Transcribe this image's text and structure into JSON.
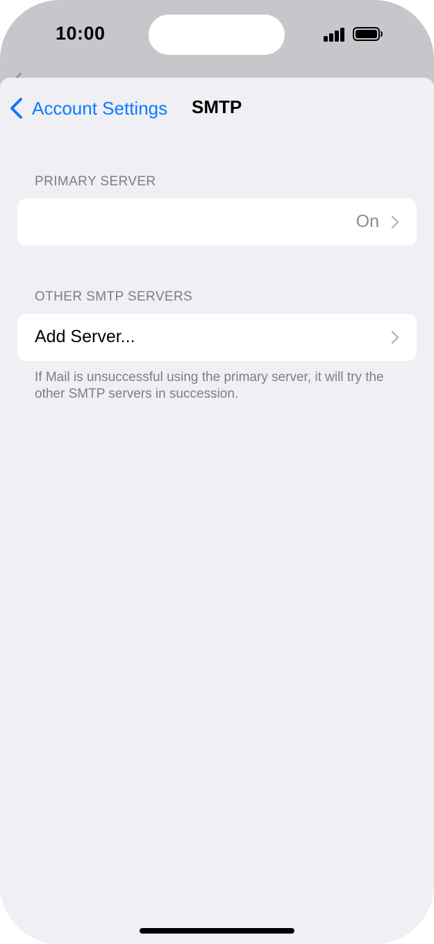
{
  "status_bar": {
    "time": "10:00"
  },
  "nav": {
    "back_label": "Account Settings",
    "title": "SMTP"
  },
  "primary_server": {
    "header": "PRIMARY SERVER",
    "value": "On"
  },
  "other_servers": {
    "header": "OTHER SMTP SERVERS",
    "add_label": "Add Server...",
    "footer": "If Mail is unsuccessful using the primary server, it will try the other SMTP servers in succession."
  },
  "colors": {
    "accent": "#0a7aff",
    "background": "#efeff4",
    "secondary_text": "#7d7d82"
  }
}
